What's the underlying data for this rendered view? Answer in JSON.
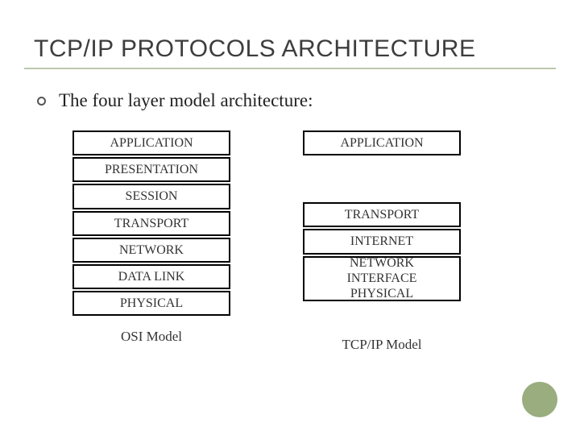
{
  "title": "TCP/IP PROTOCOLS ARCHITECTURE",
  "bullet_text": "The four layer model architecture:",
  "osi": {
    "layers": {
      "application": "APPLICATION",
      "presentation": "PRESENTATION",
      "session": "SESSION",
      "transport": "TRANSPORT",
      "network": "NETWORK",
      "datalink": "DATA LINK",
      "physical": "PHYSICAL"
    },
    "caption": "OSI Model"
  },
  "tcpip": {
    "layers": {
      "application": "APPLICATION",
      "transport": "TRANSPORT",
      "internet": "INTERNET",
      "network_interface": "NETWORK INTERFACE PHYSICAL"
    },
    "caption": "TCP/IP Model"
  },
  "accent_color": "#99ad7e",
  "underline_color": "#bcc9ad"
}
